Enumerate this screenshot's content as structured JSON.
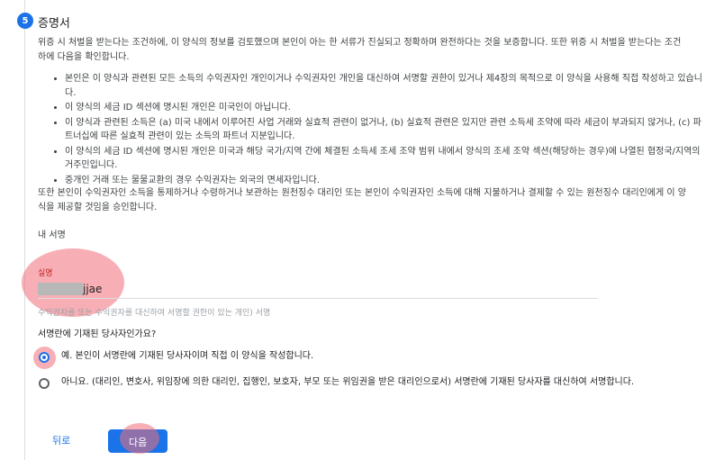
{
  "step": {
    "number": "5",
    "title": "증명서"
  },
  "intro": "위증 시 처벌을 받는다는 조건하에, 이 양식의 정보를 검토했으며 본인이 아는 한 서류가 진실되고 정확하며 완전하다는 것을 보증합니다. 또한 위증 시 처벌을 받는다는 조건하에 다음을 확인합니다.",
  "certifications": [
    "본인은 이 양식과 관련된 모든 소득의 수익권자인 개인이거나 수익권자인 개인을 대신하여 서명할 권한이 있거나 제4장의 목적으로 이 양식을 사용해 직접 작성하고 있습니다.",
    "이 양식의 세금 ID 섹션에 명시된 개인은 미국인이 아닙니다.",
    "이 양식과 관련된 소득은 (a) 미국 내에서 이루어진 사업 거래와 실효적 관련이 없거나, (b) 실효적 관련은 있지만 관련 소득세 조약에 따라 세금이 부과되지 않거나, (c) 파트너십에 따른 실효적 관련이 있는 소득의 파트너 지분입니다.",
    "이 양식의 세금 ID 섹션에 명시된 개인은 미국과 해당 국가/지역 간에 체결된 소득세 조세 조약 범위 내에서 양식의 조세 조약 섹션(해당하는 경우)에 나열된 협정국/지역의 거주민입니다.",
    "중개인 거래 또는 물물교환의 경우 수익권자는 외국의 면세자입니다."
  ],
  "authorization": "또한 본인이 수익권자인 소득을 통제하거나 수령하거나 보관하는 원천징수 대리인 또는 본인이 수익권자인 소득에 대해 지불하거나 결제할 수 있는 원천징수 대리인에게 이 양식을 제공할 것임을 승인합니다.",
  "signature": {
    "section_label": "내 서명",
    "name_label": "실명",
    "name_value": "jjae",
    "helper": "수익권자를 또는 수익권자를 대신하여 서명할 권한이 있는 개인) 서명"
  },
  "question": "서명란에 기재된 당사자인가요?",
  "options": [
    {
      "label": "예. 본인이 서명란에 기재된 당사자이며 직접 이 양식을 작성합니다.",
      "selected": true
    },
    {
      "label": "아니요. (대리인, 변호사, 위임장에 의한 대리인, 집행인, 보호자, 부모 또는 위임권을 받은 대리인으로서) 서명란에 기재된 당사자를 대신하여 서명합니다.",
      "selected": false
    }
  ],
  "buttons": {
    "back": "뒤로",
    "next": "다음"
  },
  "colors": {
    "accent": "#1a73e8",
    "highlight": "#f06e78"
  }
}
